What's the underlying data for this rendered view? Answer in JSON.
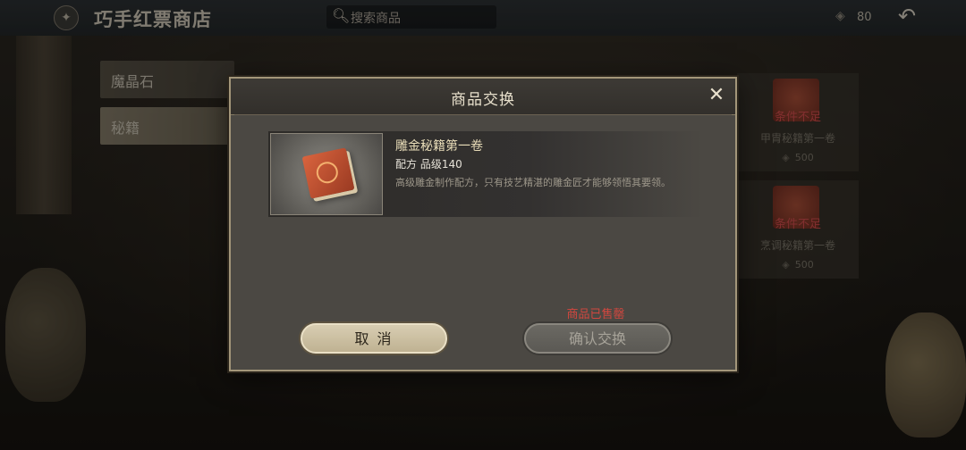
{
  "header": {
    "title": "巧手红票商店",
    "search_placeholder": "搜索商品",
    "currency_value": "80"
  },
  "categories": [
    {
      "label": "魔晶石"
    },
    {
      "label": "秘籍"
    }
  ],
  "side_cards": [
    {
      "condition": "条件不足",
      "name": "甲胄秘籍第一卷",
      "price": "500"
    },
    {
      "condition": "条件不足",
      "name": "烹调秘籍第一卷",
      "price": "500"
    }
  ],
  "dialog": {
    "title": "商品交换",
    "item": {
      "name": "雕金秘籍第一卷",
      "meta": "配方  品级140",
      "description": "高级雕金制作配方，只有技艺精湛的雕金匠才能够领悟其要领。"
    },
    "status": "商品已售罄",
    "cancel_label": "取 消",
    "confirm_label": "确认交换"
  },
  "colors": {
    "accent_gold": "#a3967a",
    "soldout_red": "#d2473f",
    "condition_red": "#d04c4c"
  }
}
